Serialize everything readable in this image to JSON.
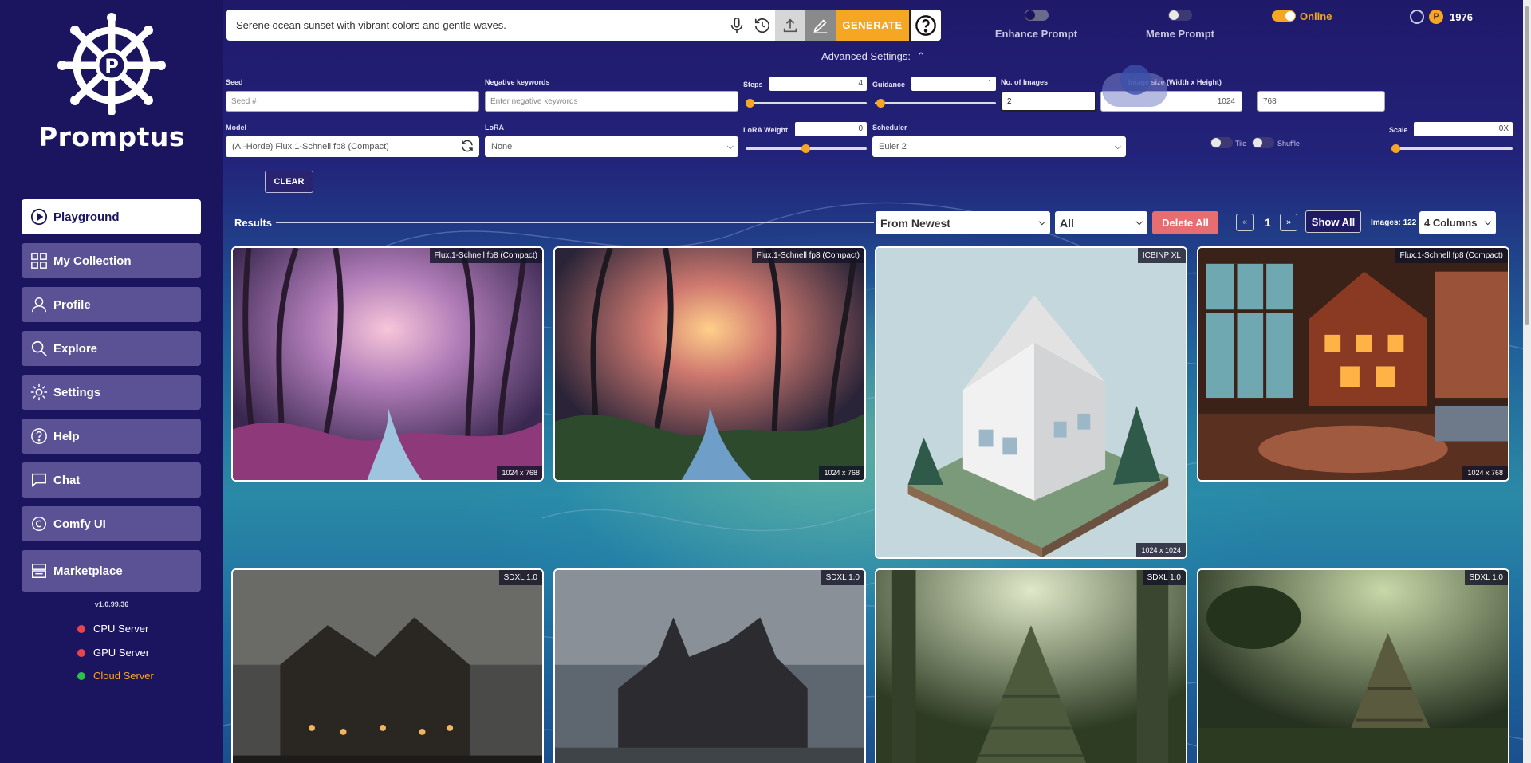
{
  "app": {
    "brand": "Promptus",
    "version": "v1.0.99.36"
  },
  "sidebar": {
    "items": [
      {
        "label": "Playground",
        "icon": "play-circle-icon"
      },
      {
        "label": "My Collection",
        "icon": "grid-icon"
      },
      {
        "label": "Profile",
        "icon": "user-icon"
      },
      {
        "label": "Explore",
        "icon": "search-icon"
      },
      {
        "label": "Settings",
        "icon": "gear-icon"
      },
      {
        "label": "Help",
        "icon": "question-icon"
      },
      {
        "label": "Chat",
        "icon": "chat-icon"
      },
      {
        "label": "Comfy UI",
        "icon": "comfy-icon"
      },
      {
        "label": "Marketplace",
        "icon": "store-icon"
      }
    ],
    "servers": [
      {
        "label": "CPU Server",
        "color": "#e8454a"
      },
      {
        "label": "GPU Server",
        "color": "#e8454a"
      },
      {
        "label": "Cloud Server",
        "color": "#2bc24a"
      }
    ]
  },
  "prompt": {
    "text": "Serene ocean sunset with vibrant colors and gentle waves.",
    "generate_label": "GENERATE"
  },
  "toggles": {
    "enhance": "Enhance Prompt",
    "meme": "Meme Prompt",
    "online": "Online"
  },
  "user": {
    "credits": "1976",
    "coin_symbol": "P"
  },
  "advanced": {
    "title": "Advanced Settings:",
    "seed_label": "Seed",
    "seed_placeholder": "Seed #",
    "neg_label": "Negative keywords",
    "neg_placeholder": "Enter negative keywords",
    "steps_label": "Steps",
    "steps_value": "4",
    "guidance_label": "Guidance",
    "guidance_value": "1",
    "num_images_label": "No. of Images",
    "num_images_value": "2",
    "image_size_label": "Image size (Width x Height)",
    "width": "1024",
    "height": "768",
    "model_label": "Model",
    "model_value": "(AI-Horde) Flux.1-Schnell fp8 (Compact)",
    "lora_label": "LoRA",
    "lora_value": "None",
    "lora_weight_label": "LoRA Weight",
    "lora_weight_value": "0",
    "scheduler_label": "Scheduler",
    "scheduler_value": "Euler 2",
    "tile_label": "Tile",
    "shuffle_label": "Shuffle",
    "scale_label": "Scale",
    "scale_value": "0X",
    "clear_label": "CLEAR"
  },
  "results": {
    "title": "Results",
    "sort": "From Newest",
    "filter": "All",
    "delete_label": "Delete All",
    "page": "1",
    "show_all_label": "Show All",
    "images_count": "Images: 122",
    "columns": "4 Columns",
    "cards": [
      {
        "tag": "Flux.1-Schnell fp8 (Compact)",
        "dims": "1024 x 768",
        "scene": "forest-purple"
      },
      {
        "tag": "Flux.1-Schnell fp8 (Compact)",
        "dims": "1024 x 768",
        "scene": "forest-sunset"
      },
      {
        "tag": "ICBINP XL",
        "dims": "1024 x 1024",
        "scene": "paper-house"
      },
      {
        "tag": "Flux.1-Schnell fp8 (Compact)",
        "dims": "1024 x 768",
        "scene": "cabin-room"
      },
      {
        "tag": "SDXL 1.0",
        "dims": "",
        "scene": "haunted-house"
      },
      {
        "tag": "SDXL 1.0",
        "dims": "",
        "scene": "gothic-manor"
      },
      {
        "tag": "SDXL 1.0",
        "dims": "",
        "scene": "jungle-temple"
      },
      {
        "tag": "SDXL 1.0",
        "dims": "",
        "scene": "jungle-ruins"
      }
    ]
  }
}
